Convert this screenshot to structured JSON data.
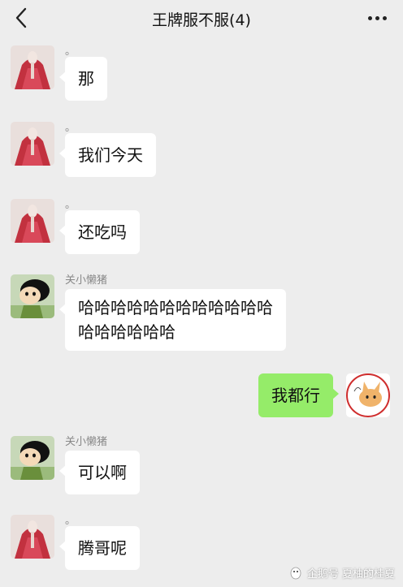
{
  "header": {
    "title": "王牌服不服(4)"
  },
  "messages": [
    {
      "sender": "。",
      "text": "那"
    },
    {
      "sender": "。",
      "text": "我们今天"
    },
    {
      "sender": "。",
      "text": "还吃吗"
    },
    {
      "sender": "关小懒猪",
      "line1": "哈哈哈哈哈哈哈哈哈哈哈哈",
      "line2": "哈哈哈哈哈哈"
    },
    {
      "text": "我都行"
    },
    {
      "sender": "关小懒猪",
      "text": "可以啊"
    },
    {
      "sender": "。",
      "text": "腾哥呢"
    }
  ],
  "watermark": {
    "text": "企鹅号 夏柚的桂夏"
  }
}
